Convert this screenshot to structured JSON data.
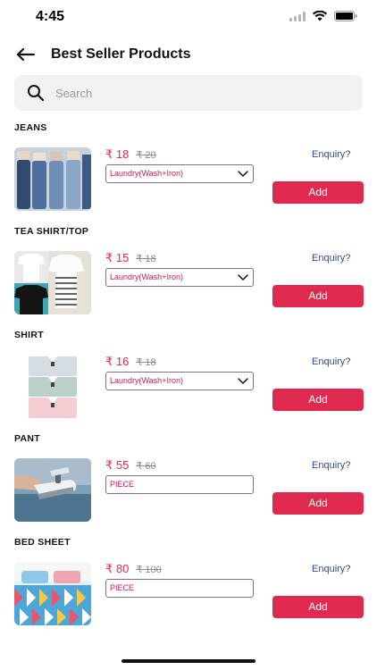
{
  "status_bar": {
    "time": "4:45"
  },
  "header": {
    "title": "Best Seller Products"
  },
  "search": {
    "placeholder": "Search"
  },
  "colors": {
    "accent": "#e0294f",
    "link": "#2f4d8a",
    "muted": "#8a8a8a"
  },
  "categories": [
    {
      "title": "JEANS",
      "price": "₹ 18",
      "old_price": "₹ 20",
      "option": "Laundry(Wash+Iron)",
      "has_dropdown": true,
      "enquiry": "Enquiry?",
      "add": "Add"
    },
    {
      "title": "TEA SHIRT/TOP",
      "price": "₹ 15",
      "old_price": "₹ 18",
      "option": "Laundry(Wash+Iron)",
      "has_dropdown": true,
      "enquiry": "Enquiry?",
      "add": "Add"
    },
    {
      "title": "SHIRT",
      "price": "₹ 16",
      "old_price": "₹ 18",
      "option": "Laundry(Wash+Iron)",
      "has_dropdown": true,
      "enquiry": "Enquiry?",
      "add": "Add"
    },
    {
      "title": "PANT",
      "price": "₹ 55",
      "old_price": "₹ 60",
      "option": "PIECE",
      "has_dropdown": false,
      "enquiry": "Enquiry?",
      "add": "Add"
    },
    {
      "title": "BED SHEET",
      "price": "₹ 80",
      "old_price": "₹ 100",
      "option": "PIECE",
      "has_dropdown": false,
      "enquiry": "Enquiry?",
      "add": "Add"
    }
  ]
}
